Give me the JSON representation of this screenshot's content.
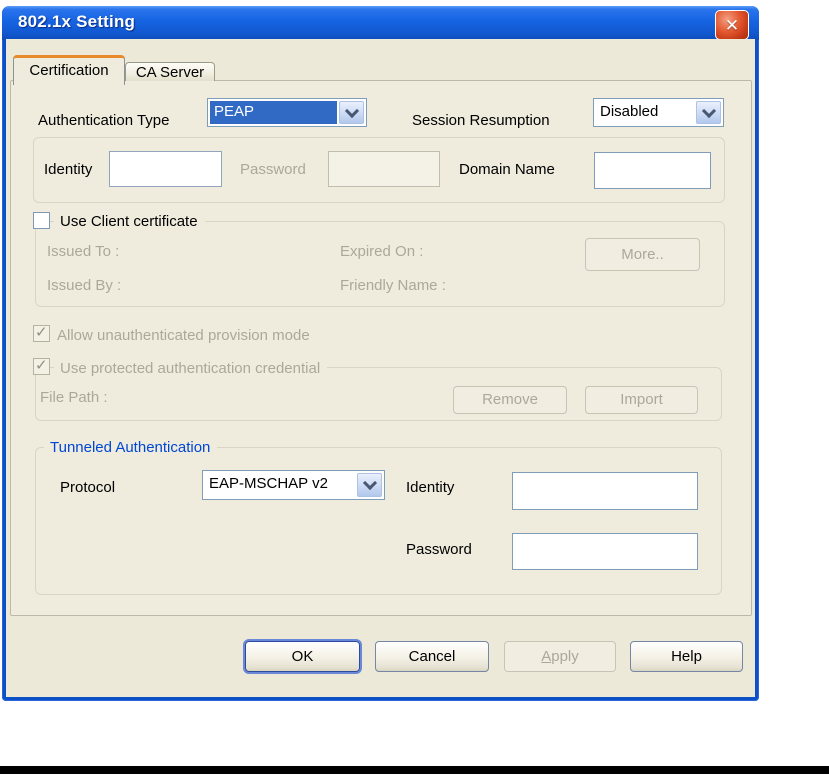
{
  "colors": {
    "titlebar_blue_top": "#2a74ec",
    "titlebar_blue_bottom": "#0d4cba",
    "window_border_blue": "#0c50c8",
    "dialog_face": "#ECE9D8",
    "tab_stripe_orange": "#E78A2B",
    "selection_blue": "#316AC5",
    "group_title_blue": "#0046D5",
    "disabled_text": "#ACA899",
    "close_button_red": "#C43A16",
    "input_border": "#7F9DB9",
    "bottom_bar_black": "#000000"
  },
  "window": {
    "title": "802.1x Setting"
  },
  "tabs": [
    {
      "label": "Certification"
    },
    {
      "label": "CA Server"
    }
  ],
  "top_row": {
    "auth_type_label": "Authentication Type",
    "auth_type_value": "PEAP",
    "session_label": "Session Resumption",
    "session_value": "Disabled"
  },
  "identity_group": {
    "identity_label": "Identity",
    "identity_value": "",
    "password_label": "Password",
    "password_value": "",
    "domain_label": "Domain Name",
    "domain_value": ""
  },
  "client_cert": {
    "checkbox_label": "Use Client certificate",
    "checkbox_checked": false,
    "issued_to_label": "Issued To :",
    "expired_on_label": "Expired On :",
    "more_button": "More..",
    "issued_by_label": "Issued By :",
    "friendly_name_label": "Friendly Name :"
  },
  "provision": {
    "allow_label": "Allow unauthenticated provision mode",
    "allow_checked": true,
    "protected_label": "Use protected authentication credential",
    "protected_checked": true,
    "file_path_label": "File Path :",
    "remove_button": "Remove",
    "import_button": "Import"
  },
  "tunneled": {
    "title": "Tunneled Authentication",
    "protocol_label": "Protocol",
    "protocol_value": "EAP-MSCHAP v2",
    "identity_label": "Identity",
    "identity_value": "",
    "password_label": "Password",
    "password_value": ""
  },
  "footer": {
    "ok": "OK",
    "cancel": "Cancel",
    "apply": "Apply",
    "help": "Help"
  },
  "icons": {
    "close": "✕",
    "check": "✓"
  }
}
